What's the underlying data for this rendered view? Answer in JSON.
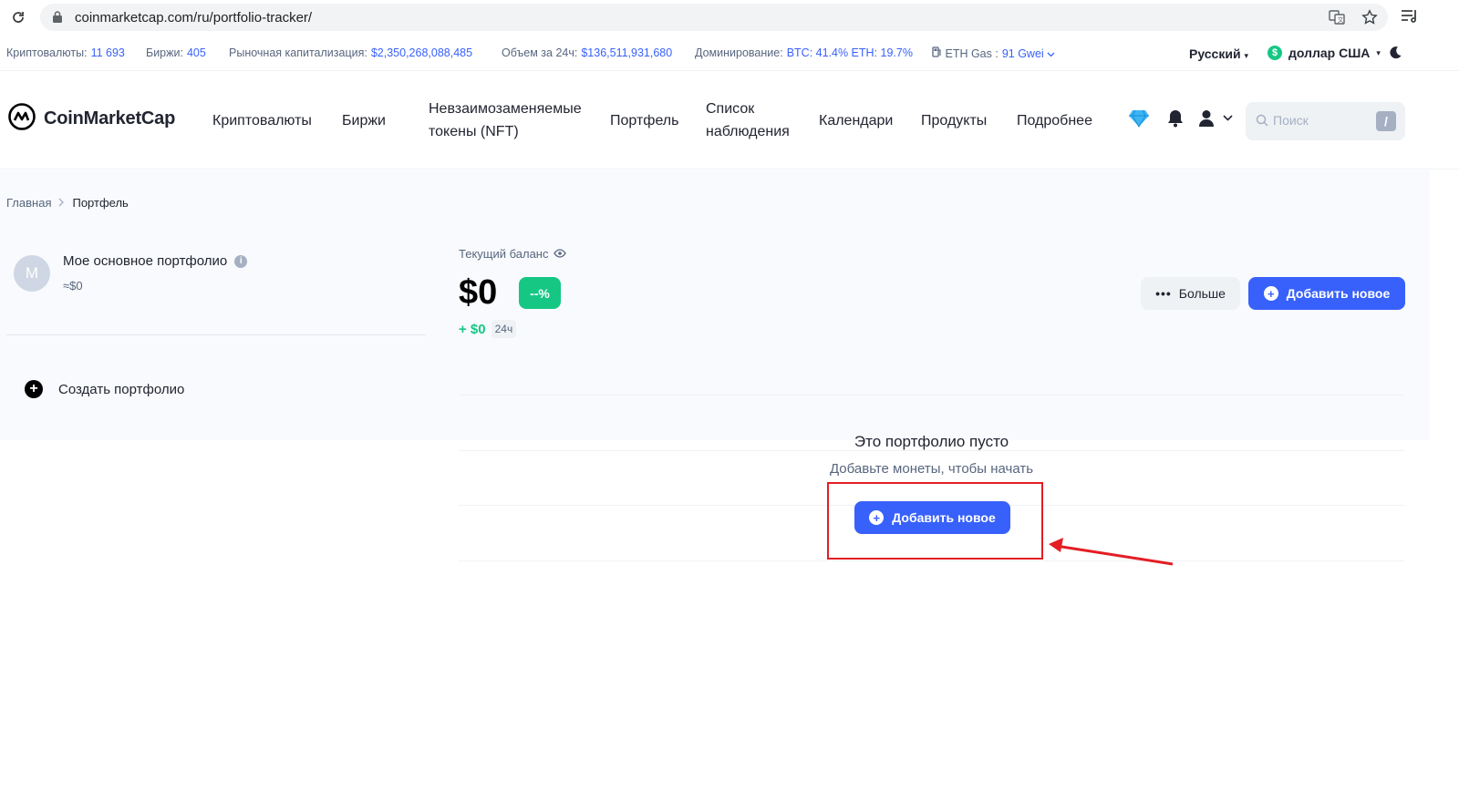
{
  "browser": {
    "url": "coinmarketcap.com/ru/portfolio-tracker/"
  },
  "stats": {
    "cryptos_label": "Криптовалюты:",
    "cryptos_value": "11 693",
    "exchanges_label": "Биржи:",
    "exchanges_value": "405",
    "marketcap_label": "Рыночная капитализация:",
    "marketcap_value": "$2,350,268,088,485",
    "volume_label": "Объем за 24ч:",
    "volume_value": "$136,511,931,680",
    "dominance_label": "Доминирование:",
    "dominance_value": "BTC: 41.4% ETH: 19.7%",
    "gas_label": "ETH Gas :",
    "gas_value": "91 Gwei",
    "language": "Русский",
    "currency": "доллар США"
  },
  "nav": {
    "logo": "CoinMarketCap",
    "items": [
      "Криптовалюты",
      "Биржи",
      "Невзаимозаменяемые",
      "токены (NFT)",
      "Портфель",
      "Список",
      "наблюдения",
      "Календари",
      "Продукты",
      "Подробнее"
    ],
    "search_placeholder": "Поиск",
    "search_shortcut": "/"
  },
  "breadcrumb": {
    "home": "Главная",
    "current": "Портфель"
  },
  "sidebar": {
    "portfolio_avatar": "M",
    "portfolio_name": "Мое основное портфолио",
    "portfolio_value": "≈$0",
    "create_label": "Создать портфолио"
  },
  "main": {
    "balance_label": "Текущий баланс",
    "balance": "$0",
    "percent_badge": "--%",
    "change_value": "+ $0",
    "change_period": "24ч",
    "more_label": "Больше",
    "add_new_label": "Добавить новое",
    "empty_title": "Это портфолио пусто",
    "empty_subtitle": "Добавьте монеты, чтобы начать",
    "empty_add_label": "Добавить новое"
  },
  "colors": {
    "accent": "#3861fb",
    "positive": "#16c784",
    "annotation": "#e31e24"
  }
}
